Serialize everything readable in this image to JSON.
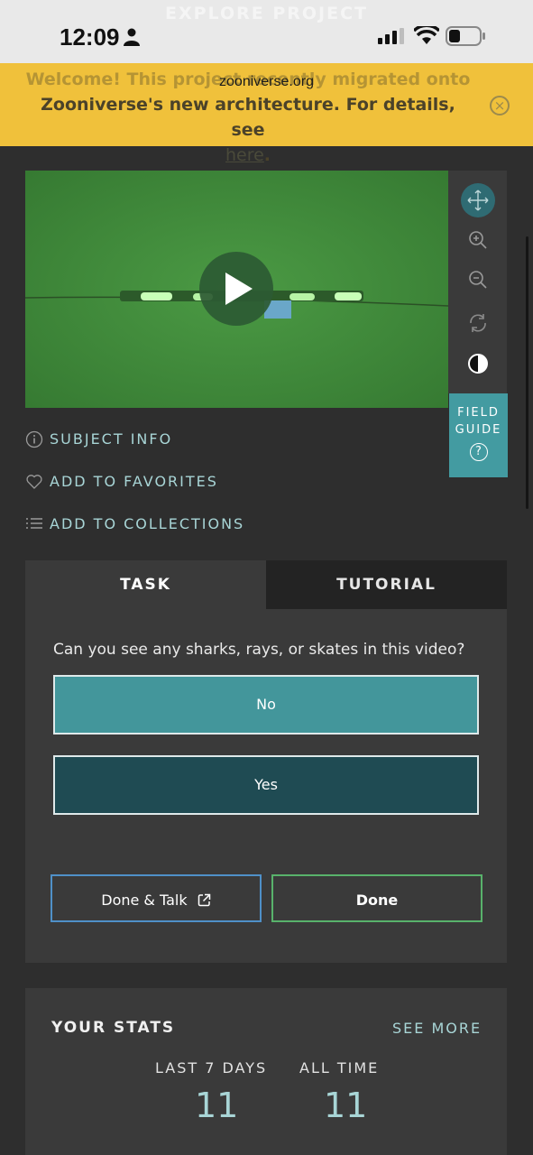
{
  "status_bar": {
    "time": "12:09",
    "ghost_nav": "EXPLORE PROJECT"
  },
  "browser": {
    "url": "zooniverse.org"
  },
  "banner": {
    "line1": "Welcome! This project recently migrated onto",
    "line2": "Zooniverse's new architecture. For details, see",
    "link": "here",
    "after_link": "."
  },
  "viewer": {
    "tools": [
      "move-icon",
      "zoom-in-icon",
      "zoom-out-icon",
      "rotate-icon",
      "invert-icon"
    ],
    "field_guide": {
      "line1": "FIELD",
      "line2": "GUIDE",
      "icon": "?"
    }
  },
  "meta": {
    "subject_info": "SUBJECT INFO",
    "favorites": "ADD TO FAVORITES",
    "collections": "ADD TO COLLECTIONS"
  },
  "tabs": {
    "task": "TASK",
    "tutorial": "TUTORIAL"
  },
  "task": {
    "question": "Can you see any sharks, rays, or skates in this video?",
    "answers": [
      "No",
      "Yes"
    ]
  },
  "actions": {
    "done_talk": "Done & Talk",
    "done": "Done"
  },
  "stats": {
    "title": "YOUR STATS",
    "see_more": "SEE MORE",
    "last7_label": "LAST 7 DAYS",
    "last7_value": "11",
    "alltime_label": "ALL TIME",
    "alltime_value": "11"
  },
  "colors": {
    "banner": "#f0c13b",
    "accent_teal": "#43969b",
    "dark_teal": "#1f4b53",
    "link_teal": "#a8d5d6",
    "done_green": "#58b26b",
    "talk_blue": "#4f90c8",
    "panel": "#3a3a3a",
    "background": "#2e2e2e"
  }
}
